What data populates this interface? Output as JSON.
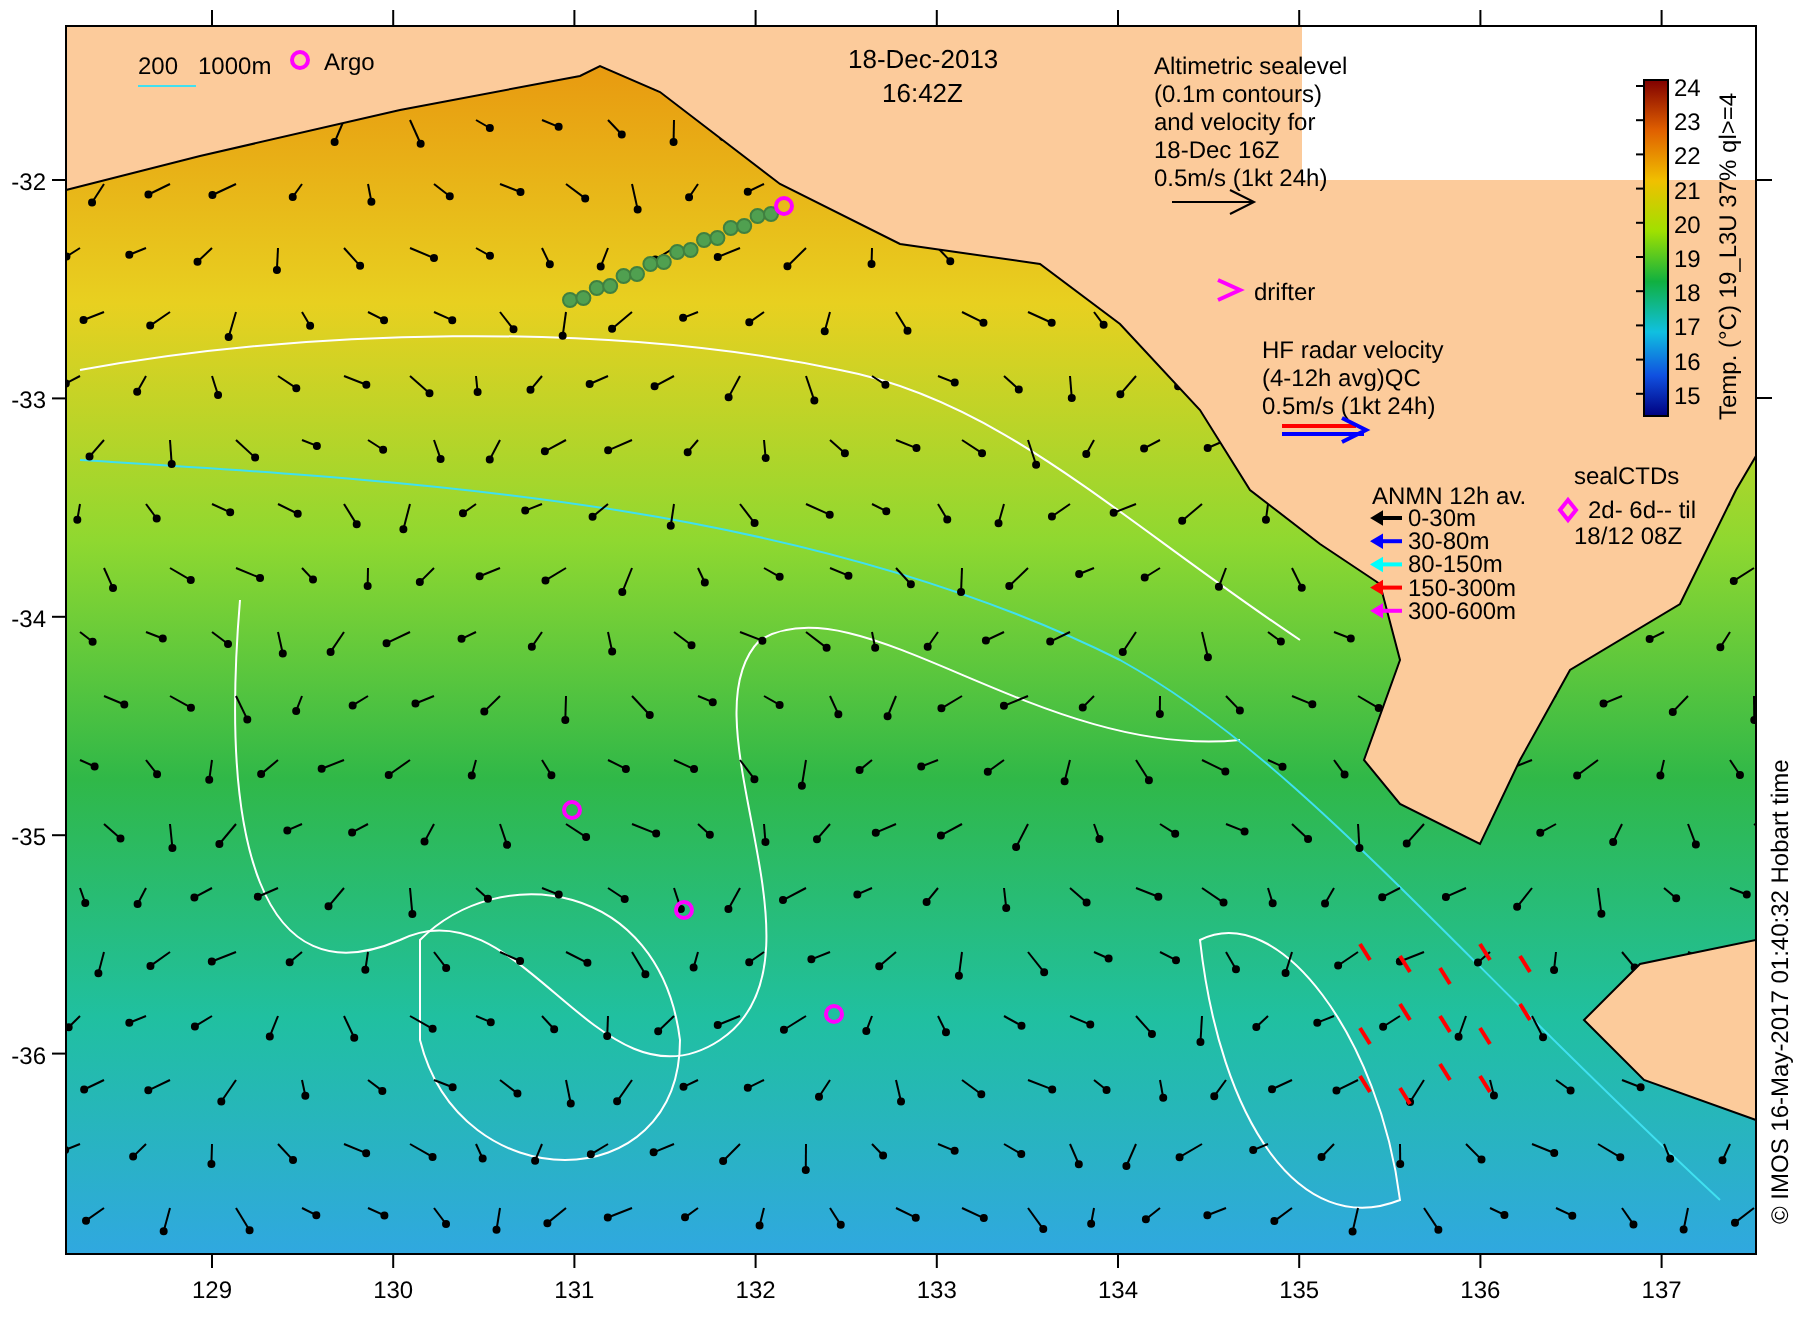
{
  "header": {
    "date": "18-Dec-2013",
    "time": "16:42Z"
  },
  "depth_key": {
    "labels": [
      "200",
      "1000m"
    ]
  },
  "argo_key": {
    "label": "Argo"
  },
  "altimetry_key": {
    "lines": [
      "Altimetric sealevel",
      "(0.1m contours)",
      "and velocity for",
      "18-Dec 16Z",
      "0.5m/s (1kt 24h)"
    ]
  },
  "drifter_key": {
    "label": "drifter"
  },
  "hf_radar_key": {
    "lines": [
      "HF radar velocity",
      "(4-12h avg)QC",
      "0.5m/s (1kt 24h)"
    ]
  },
  "anmn_key": {
    "title": "ANMN 12h av.",
    "items": [
      {
        "label": "0-30m",
        "color": "#000000"
      },
      {
        "label": "30-80m",
        "color": "#0000ff"
      },
      {
        "label": "80-150m",
        "color": "#00ffff"
      },
      {
        "label": "150-300m",
        "color": "#ff0000"
      },
      {
        "label": "300-600m",
        "color": "#ff00ff"
      }
    ]
  },
  "seal_key": {
    "lines": [
      "sealCTDs",
      "2d- 6d-- til",
      "18/12 08Z"
    ]
  },
  "colorbar": {
    "ticks": [
      "24",
      "23",
      "22",
      "21",
      "20",
      "19",
      "18",
      "17",
      "16",
      "15"
    ],
    "label": "Temp. (°C) 19_L3U 37% ql>=4"
  },
  "axes": {
    "lon_ticks": [
      "129",
      "130",
      "131",
      "132",
      "133",
      "134",
      "135",
      "136",
      "137"
    ],
    "lat_ticks": [
      "-32",
      "-33",
      "-34",
      "-35",
      "-36"
    ]
  },
  "credit": "© IMOS 16-May-2017 01:40:32 Hobart time"
}
